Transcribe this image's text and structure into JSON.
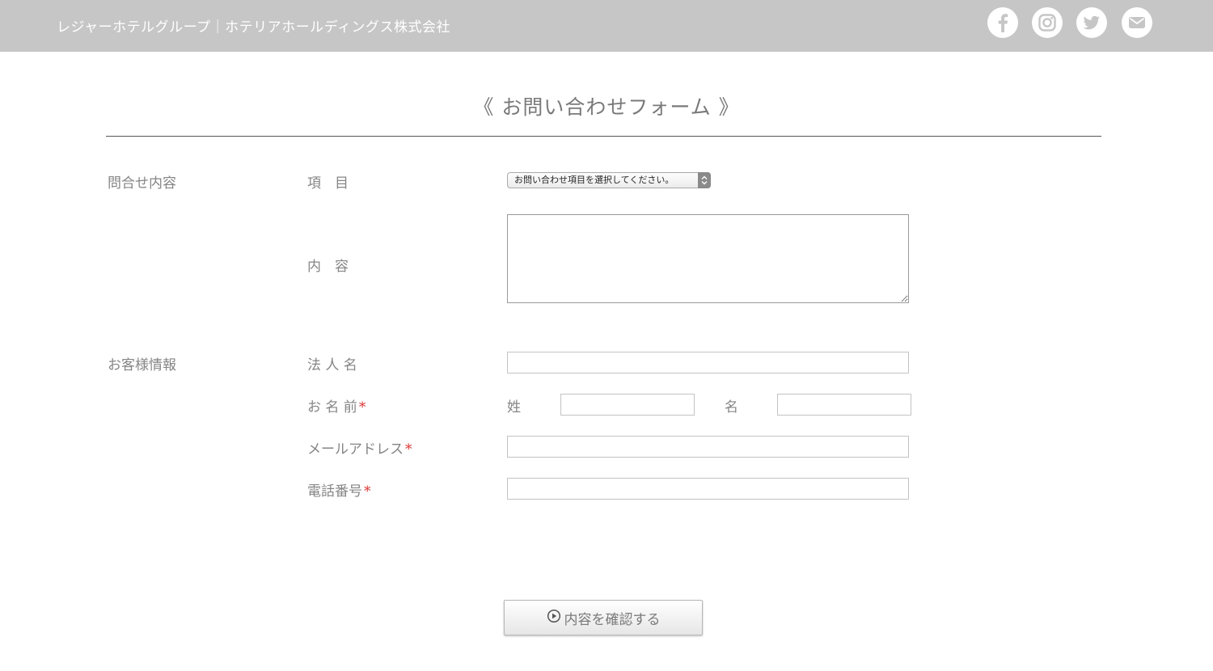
{
  "header": {
    "title": "レジャーホテルグループ｜ホテリアホールディングス株式会社",
    "social": [
      "facebook-icon",
      "instagram-icon",
      "twitter-icon",
      "mail-icon"
    ],
    "background": "#c6c6c6"
  },
  "form": {
    "title": "《 お問い合わせフォーム 》",
    "sections": {
      "inquiry": "問合せ内容",
      "customer": "お客様情報"
    },
    "fields": {
      "item_label": "項　目",
      "item_select_value": "お問い合わせ項目を選択してください。",
      "content_label": "内　容",
      "company_label": "法 人 名",
      "name_label": "お 名 前",
      "last_name_label": "姓",
      "first_name_label": "名",
      "email_label": "メールアドレス",
      "phone_label": "電話番号",
      "required_mark": "*"
    },
    "confirm_button": "内容を確認する"
  }
}
